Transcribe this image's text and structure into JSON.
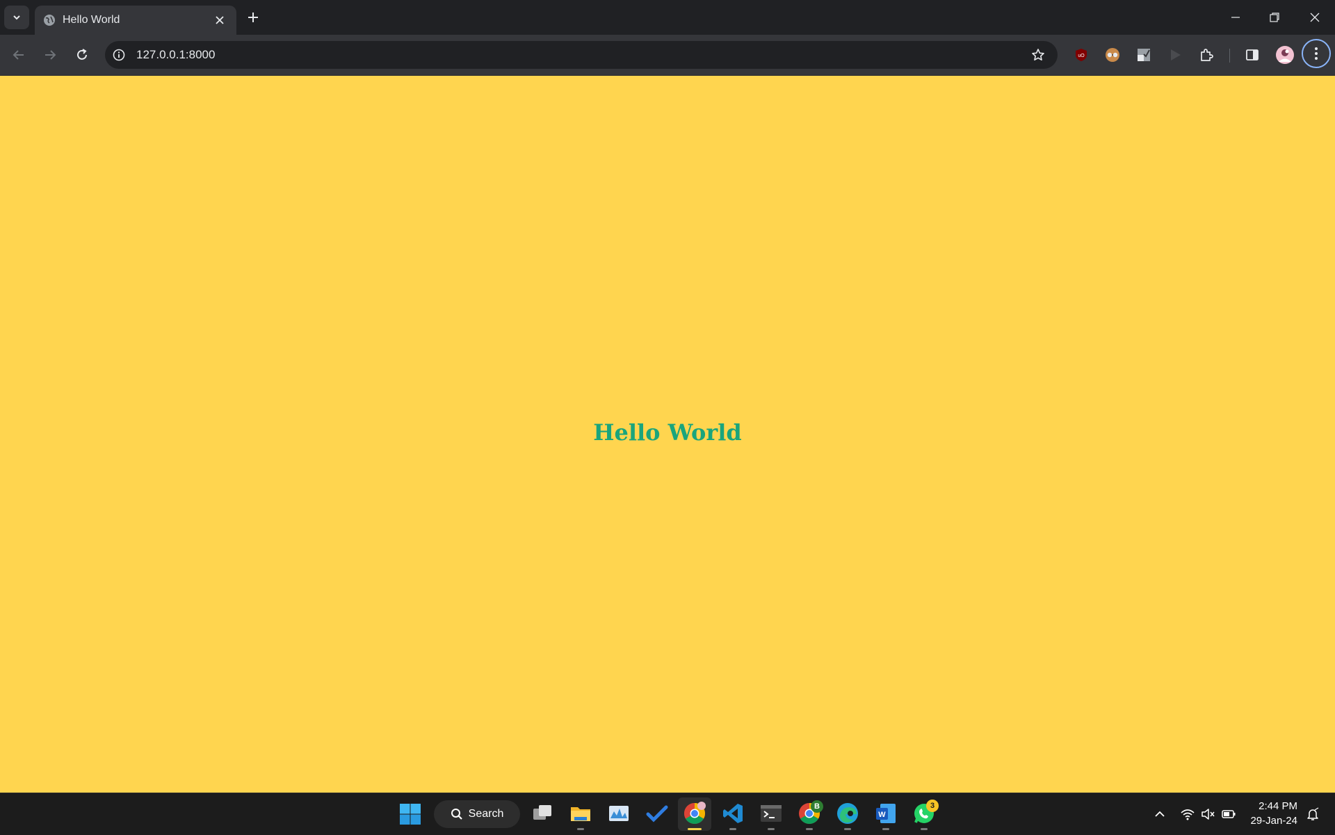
{
  "browser": {
    "tab": {
      "title": "Hello World"
    },
    "address_bar": {
      "url": "127.0.0.1:8000"
    }
  },
  "page": {
    "heading": "Hello World",
    "background_color": "#ffd54f",
    "heading_color": "#1aa57c"
  },
  "taskbar": {
    "search_label": "Search",
    "whatsapp_badge": "3",
    "chrome_profile_badge": "B",
    "clock": {
      "time": "2:44 PM",
      "date": "29-Jan-24"
    }
  },
  "icons": {
    "tabstrip": [
      "tab-search-icon",
      "globe-icon",
      "close-icon",
      "plus-icon",
      "minimize-icon",
      "restore-icon",
      "window-close-icon"
    ],
    "toolbar": [
      "back-arrow-icon",
      "forward-arrow-icon",
      "reload-icon",
      "info-icon",
      "star-icon",
      "ublock-icon",
      "glasses-extension-icon",
      "extension-icon",
      "play-extension-icon",
      "puzzle-icon",
      "side-panel-icon",
      "profile-avatar",
      "more-menu-icon"
    ],
    "taskbar": [
      "windows-start-icon",
      "search-icon",
      "task-view-icon",
      "file-explorer-icon",
      "resource-monitor-icon",
      "todo-icon",
      "chrome-icon",
      "vscode-icon",
      "terminal-icon",
      "chrome-profile-icon",
      "edge-icon",
      "word-icon",
      "whatsapp-icon"
    ],
    "tray": [
      "chevron-up-icon",
      "wifi-icon",
      "speaker-muted-icon",
      "battery-icon",
      "notification-icon"
    ]
  }
}
